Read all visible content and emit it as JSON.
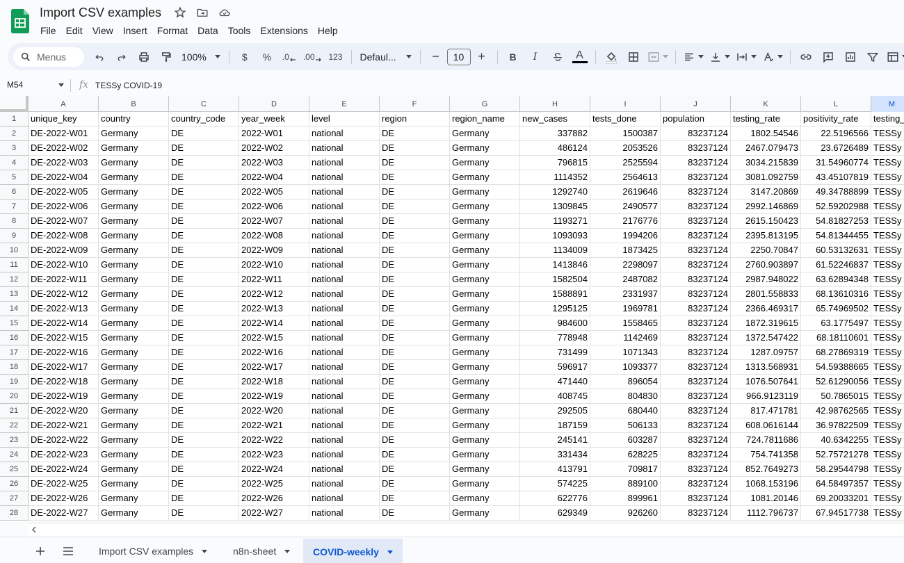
{
  "app": {
    "doc_title": "Import CSV examples",
    "menus": [
      "File",
      "Edit",
      "View",
      "Insert",
      "Format",
      "Data",
      "Tools",
      "Extensions",
      "Help"
    ]
  },
  "toolbar": {
    "search_placeholder": "Menus",
    "zoom": "100%",
    "currency": "$",
    "percent": "%",
    "decrease_decimal": ".0",
    "increase_decimal": ".00",
    "number_format": "123",
    "font": "Defaul...",
    "font_size": "10",
    "bold": "B",
    "italic": "I",
    "text_color_glyph": "A",
    "minus": "−",
    "plus": "+"
  },
  "formula_bar": {
    "cell_ref": "M54",
    "content": "TESSy COVID-19"
  },
  "grid": {
    "columns": [
      "A",
      "B",
      "C",
      "D",
      "E",
      "F",
      "G",
      "H",
      "I",
      "J",
      "K",
      "L",
      "M"
    ],
    "selected_column": "M",
    "headers": [
      "unique_key",
      "country",
      "country_code",
      "year_week",
      "level",
      "region",
      "region_name",
      "new_cases",
      "tests_done",
      "population",
      "testing_rate",
      "positivity_rate",
      "testing_"
    ],
    "rows": [
      [
        "DE-2022-W01",
        "Germany",
        "DE",
        "2022-W01",
        "national",
        "DE",
        "Germany",
        "337882",
        "1500387",
        "83237124",
        "1802.54546",
        "22.5196566",
        "TESSy"
      ],
      [
        "DE-2022-W02",
        "Germany",
        "DE",
        "2022-W02",
        "national",
        "DE",
        "Germany",
        "486124",
        "2053526",
        "83237124",
        "2467.079473",
        "23.6726489",
        "TESSy"
      ],
      [
        "DE-2022-W03",
        "Germany",
        "DE",
        "2022-W03",
        "national",
        "DE",
        "Germany",
        "796815",
        "2525594",
        "83237124",
        "3034.215839",
        "31.54960774",
        "TESSy"
      ],
      [
        "DE-2022-W04",
        "Germany",
        "DE",
        "2022-W04",
        "national",
        "DE",
        "Germany",
        "1114352",
        "2564613",
        "83237124",
        "3081.092759",
        "43.45107819",
        "TESSy"
      ],
      [
        "DE-2022-W05",
        "Germany",
        "DE",
        "2022-W05",
        "national",
        "DE",
        "Germany",
        "1292740",
        "2619646",
        "83237124",
        "3147.20869",
        "49.34788899",
        "TESSy"
      ],
      [
        "DE-2022-W06",
        "Germany",
        "DE",
        "2022-W06",
        "national",
        "DE",
        "Germany",
        "1309845",
        "2490577",
        "83237124",
        "2992.146869",
        "52.59202988",
        "TESSy"
      ],
      [
        "DE-2022-W07",
        "Germany",
        "DE",
        "2022-W07",
        "national",
        "DE",
        "Germany",
        "1193271",
        "2176776",
        "83237124",
        "2615.150423",
        "54.81827253",
        "TESSy"
      ],
      [
        "DE-2022-W08",
        "Germany",
        "DE",
        "2022-W08",
        "national",
        "DE",
        "Germany",
        "1093093",
        "1994206",
        "83237124",
        "2395.813195",
        "54.81344455",
        "TESSy"
      ],
      [
        "DE-2022-W09",
        "Germany",
        "DE",
        "2022-W09",
        "national",
        "DE",
        "Germany",
        "1134009",
        "1873425",
        "83237124",
        "2250.70847",
        "60.53132631",
        "TESSy"
      ],
      [
        "DE-2022-W10",
        "Germany",
        "DE",
        "2022-W10",
        "national",
        "DE",
        "Germany",
        "1413846",
        "2298097",
        "83237124",
        "2760.903897",
        "61.52246837",
        "TESSy"
      ],
      [
        "DE-2022-W11",
        "Germany",
        "DE",
        "2022-W11",
        "national",
        "DE",
        "Germany",
        "1582504",
        "2487082",
        "83237124",
        "2987.948022",
        "63.62894348",
        "TESSy"
      ],
      [
        "DE-2022-W12",
        "Germany",
        "DE",
        "2022-W12",
        "national",
        "DE",
        "Germany",
        "1588891",
        "2331937",
        "83237124",
        "2801.558833",
        "68.13610316",
        "TESSy"
      ],
      [
        "DE-2022-W13",
        "Germany",
        "DE",
        "2022-W13",
        "national",
        "DE",
        "Germany",
        "1295125",
        "1969781",
        "83237124",
        "2366.469317",
        "65.74969502",
        "TESSy"
      ],
      [
        "DE-2022-W14",
        "Germany",
        "DE",
        "2022-W14",
        "national",
        "DE",
        "Germany",
        "984600",
        "1558465",
        "83237124",
        "1872.319615",
        "63.1775497",
        "TESSy"
      ],
      [
        "DE-2022-W15",
        "Germany",
        "DE",
        "2022-W15",
        "national",
        "DE",
        "Germany",
        "778948",
        "1142469",
        "83237124",
        "1372.547422",
        "68.18110601",
        "TESSy"
      ],
      [
        "DE-2022-W16",
        "Germany",
        "DE",
        "2022-W16",
        "national",
        "DE",
        "Germany",
        "731499",
        "1071343",
        "83237124",
        "1287.09757",
        "68.27869319",
        "TESSy"
      ],
      [
        "DE-2022-W17",
        "Germany",
        "DE",
        "2022-W17",
        "national",
        "DE",
        "Germany",
        "596917",
        "1093377",
        "83237124",
        "1313.568931",
        "54.59388665",
        "TESSy"
      ],
      [
        "DE-2022-W18",
        "Germany",
        "DE",
        "2022-W18",
        "national",
        "DE",
        "Germany",
        "471440",
        "896054",
        "83237124",
        "1076.507641",
        "52.61290056",
        "TESSy"
      ],
      [
        "DE-2022-W19",
        "Germany",
        "DE",
        "2022-W19",
        "national",
        "DE",
        "Germany",
        "408745",
        "804830",
        "83237124",
        "966.9123119",
        "50.7865015",
        "TESSy"
      ],
      [
        "DE-2022-W20",
        "Germany",
        "DE",
        "2022-W20",
        "national",
        "DE",
        "Germany",
        "292505",
        "680440",
        "83237124",
        "817.471781",
        "42.98762565",
        "TESSy"
      ],
      [
        "DE-2022-W21",
        "Germany",
        "DE",
        "2022-W21",
        "national",
        "DE",
        "Germany",
        "187159",
        "506133",
        "83237124",
        "608.0616144",
        "36.97822509",
        "TESSy"
      ],
      [
        "DE-2022-W22",
        "Germany",
        "DE",
        "2022-W22",
        "national",
        "DE",
        "Germany",
        "245141",
        "603287",
        "83237124",
        "724.7811686",
        "40.6342255",
        "TESSy"
      ],
      [
        "DE-2022-W23",
        "Germany",
        "DE",
        "2022-W23",
        "national",
        "DE",
        "Germany",
        "331434",
        "628225",
        "83237124",
        "754.741358",
        "52.75721278",
        "TESSy"
      ],
      [
        "DE-2022-W24",
        "Germany",
        "DE",
        "2022-W24",
        "national",
        "DE",
        "Germany",
        "413791",
        "709817",
        "83237124",
        "852.7649273",
        "58.29544798",
        "TESSy"
      ],
      [
        "DE-2022-W25",
        "Germany",
        "DE",
        "2022-W25",
        "national",
        "DE",
        "Germany",
        "574225",
        "889100",
        "83237124",
        "1068.153196",
        "64.58497357",
        "TESSy"
      ],
      [
        "DE-2022-W26",
        "Germany",
        "DE",
        "2022-W26",
        "national",
        "DE",
        "Germany",
        "622776",
        "899961",
        "83237124",
        "1081.20146",
        "69.20033201",
        "TESSy"
      ],
      [
        "DE-2022-W27",
        "Germany",
        "DE",
        "2022-W27",
        "national",
        "DE",
        "Germany",
        "629349",
        "926260",
        "83237124",
        "1112.796737",
        "67.94517738",
        "TESSy"
      ]
    ]
  },
  "sheets": {
    "tabs": [
      {
        "label": "Import CSV examples",
        "active": false
      },
      {
        "label": "n8n-sheet",
        "active": false
      },
      {
        "label": "COVID-weekly",
        "active": true
      }
    ]
  },
  "colors": {
    "accent": "#0b57d0",
    "selected_header": "#d3e3fd",
    "toolbar_bg": "#edf2fa",
    "logo_green": "#0f9d58"
  }
}
